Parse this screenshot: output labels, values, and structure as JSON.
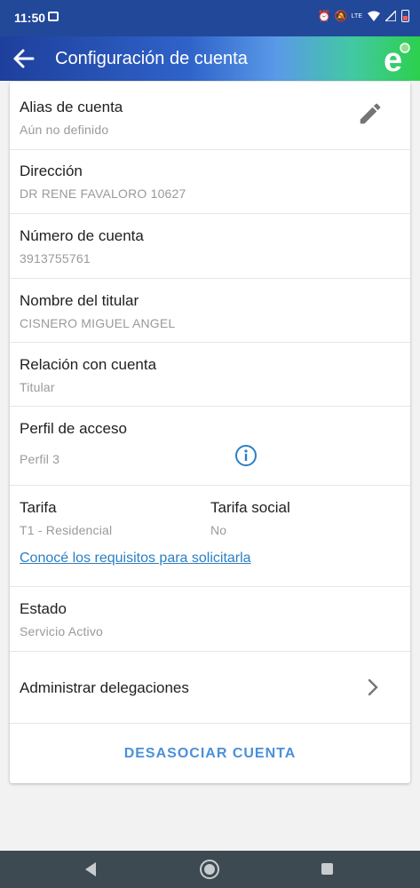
{
  "status_bar": {
    "time": "11:50",
    "lte_label": "LTE"
  },
  "app_bar": {
    "title": "Configuración de cuenta",
    "logo_letter": "e"
  },
  "fields": {
    "alias": {
      "label": "Alias de cuenta",
      "value": "Aún no definido"
    },
    "address": {
      "label": "Dirección",
      "value": "DR RENE FAVALORO 10627"
    },
    "account_number": {
      "label": "Número de cuenta",
      "value": "3913755761"
    },
    "holder_name": {
      "label": "Nombre del titular",
      "value": "CISNERO MIGUEL ANGEL"
    },
    "relation": {
      "label": "Relación con cuenta",
      "value": "Titular"
    },
    "access_profile": {
      "label": "Perfil de acceso",
      "value": "Perfil 3"
    },
    "tariff": {
      "label": "Tarifa",
      "value": "T1 - Residencial"
    },
    "social_tariff": {
      "label": "Tarifa social",
      "value": "No"
    },
    "requirements_link": "Conocé los requisitos para solicitarla",
    "state": {
      "label": "Estado",
      "value": "Servicio Activo"
    }
  },
  "manage_delegations": "Administrar delegaciones",
  "unlink_button": "DESASOCIAR CUENTA",
  "icons": {
    "back": "arrow-left",
    "edit": "pencil",
    "info": "info-circle",
    "chevron": "chevron-right"
  },
  "colors": {
    "accent": "#4a90d9",
    "link": "#2b7fc4",
    "status_bar": "#22489a",
    "nav_bar": "#3d4a52"
  }
}
